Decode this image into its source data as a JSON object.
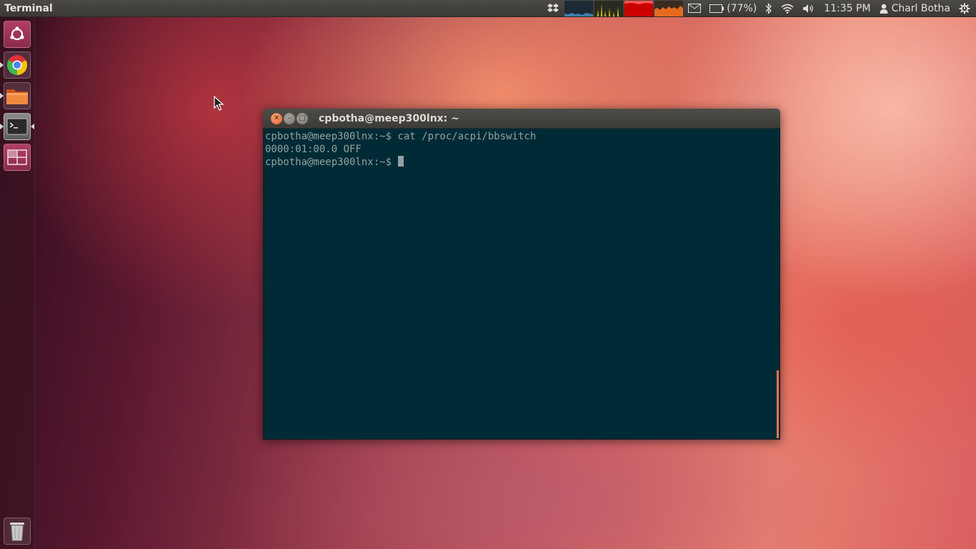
{
  "top_panel": {
    "app_title": "Terminal",
    "battery_text": "(77%)",
    "clock": "11:35 PM",
    "user_name": "Charl Botha",
    "icons": [
      "dropbox-icon",
      "system-load-graphs",
      "mail-icon",
      "battery-icon",
      "bluetooth-icon",
      "wifi-icon",
      "volume-icon",
      "user-icon",
      "session-gear-icon"
    ]
  },
  "launcher": {
    "items": [
      {
        "name": "dash-home",
        "icon": "ubuntu-logo-icon"
      },
      {
        "name": "chrome",
        "icon": "chrome-icon"
      },
      {
        "name": "files",
        "icon": "folder-icon"
      },
      {
        "name": "terminal",
        "icon": "terminal-icon"
      },
      {
        "name": "workspace-switcher",
        "icon": "workspace-icon"
      },
      {
        "name": "trash",
        "icon": "trash-icon"
      }
    ]
  },
  "terminal_window": {
    "title": "cpbotha@meep300lnx: ~",
    "lines": [
      "cpbotha@meep300lnx:~$ cat /proc/acpi/bbswitch",
      "0000:01:00.0 OFF",
      "cpbotha@meep300lnx:~$ "
    ],
    "colors": {
      "background": "#002b36",
      "foreground": "#93a1a1"
    }
  }
}
